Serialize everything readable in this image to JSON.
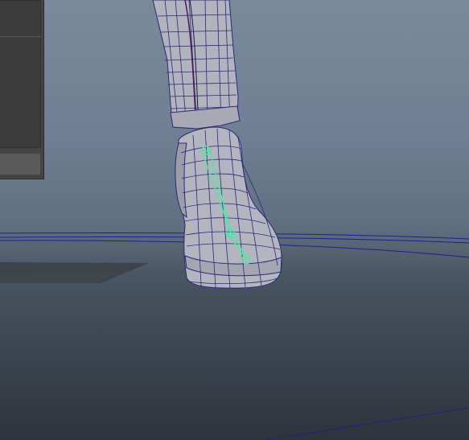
{
  "app": {
    "view": "3d-viewport-perspective",
    "object": "character-leg-and-boot-wireframe",
    "selection": "foot-joint-chain"
  },
  "colors": {
    "viewport_top": "#7a8a9c",
    "viewport_bottom": "#2e343c",
    "mesh_fill": "#b3b3bf",
    "wireframe": "#2a2a7a",
    "selected_joint": "#3ef0a0",
    "ground_grid": "#20208c",
    "panel_bg": "#444444"
  },
  "icons": {
    "joint": "circle-joint-icon",
    "bone": "triangle-bone-icon"
  }
}
